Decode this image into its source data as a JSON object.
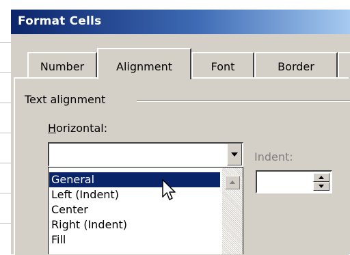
{
  "dialog": {
    "title": "Format Cells"
  },
  "tabs": [
    {
      "label": "Number",
      "active": false
    },
    {
      "label": "Alignment",
      "active": true
    },
    {
      "label": "Font",
      "active": false
    },
    {
      "label": "Border",
      "active": false
    }
  ],
  "alignment": {
    "group_label": "Text alignment",
    "horizontal_label": "Horizontal:",
    "horizontal_value": "",
    "indent_label": "Indent:",
    "indent_value": ""
  },
  "horizontal_options": [
    {
      "label": "General",
      "selected": true
    },
    {
      "label": "Left (Indent)",
      "selected": false
    },
    {
      "label": "Center",
      "selected": false
    },
    {
      "label": "Right (Indent)",
      "selected": false
    },
    {
      "label": "Fill",
      "selected": false
    }
  ],
  "colors": {
    "selection": "#0a246a",
    "dialog_face": "#d4d0c8",
    "title_gradient_start": "#0b246a",
    "title_gradient_end": "#a6caf0"
  },
  "icons": [
    "dropdown-arrow-icon",
    "spin-up-icon",
    "spin-down-icon",
    "scroll-up-icon",
    "mouse-pointer-icon"
  ]
}
